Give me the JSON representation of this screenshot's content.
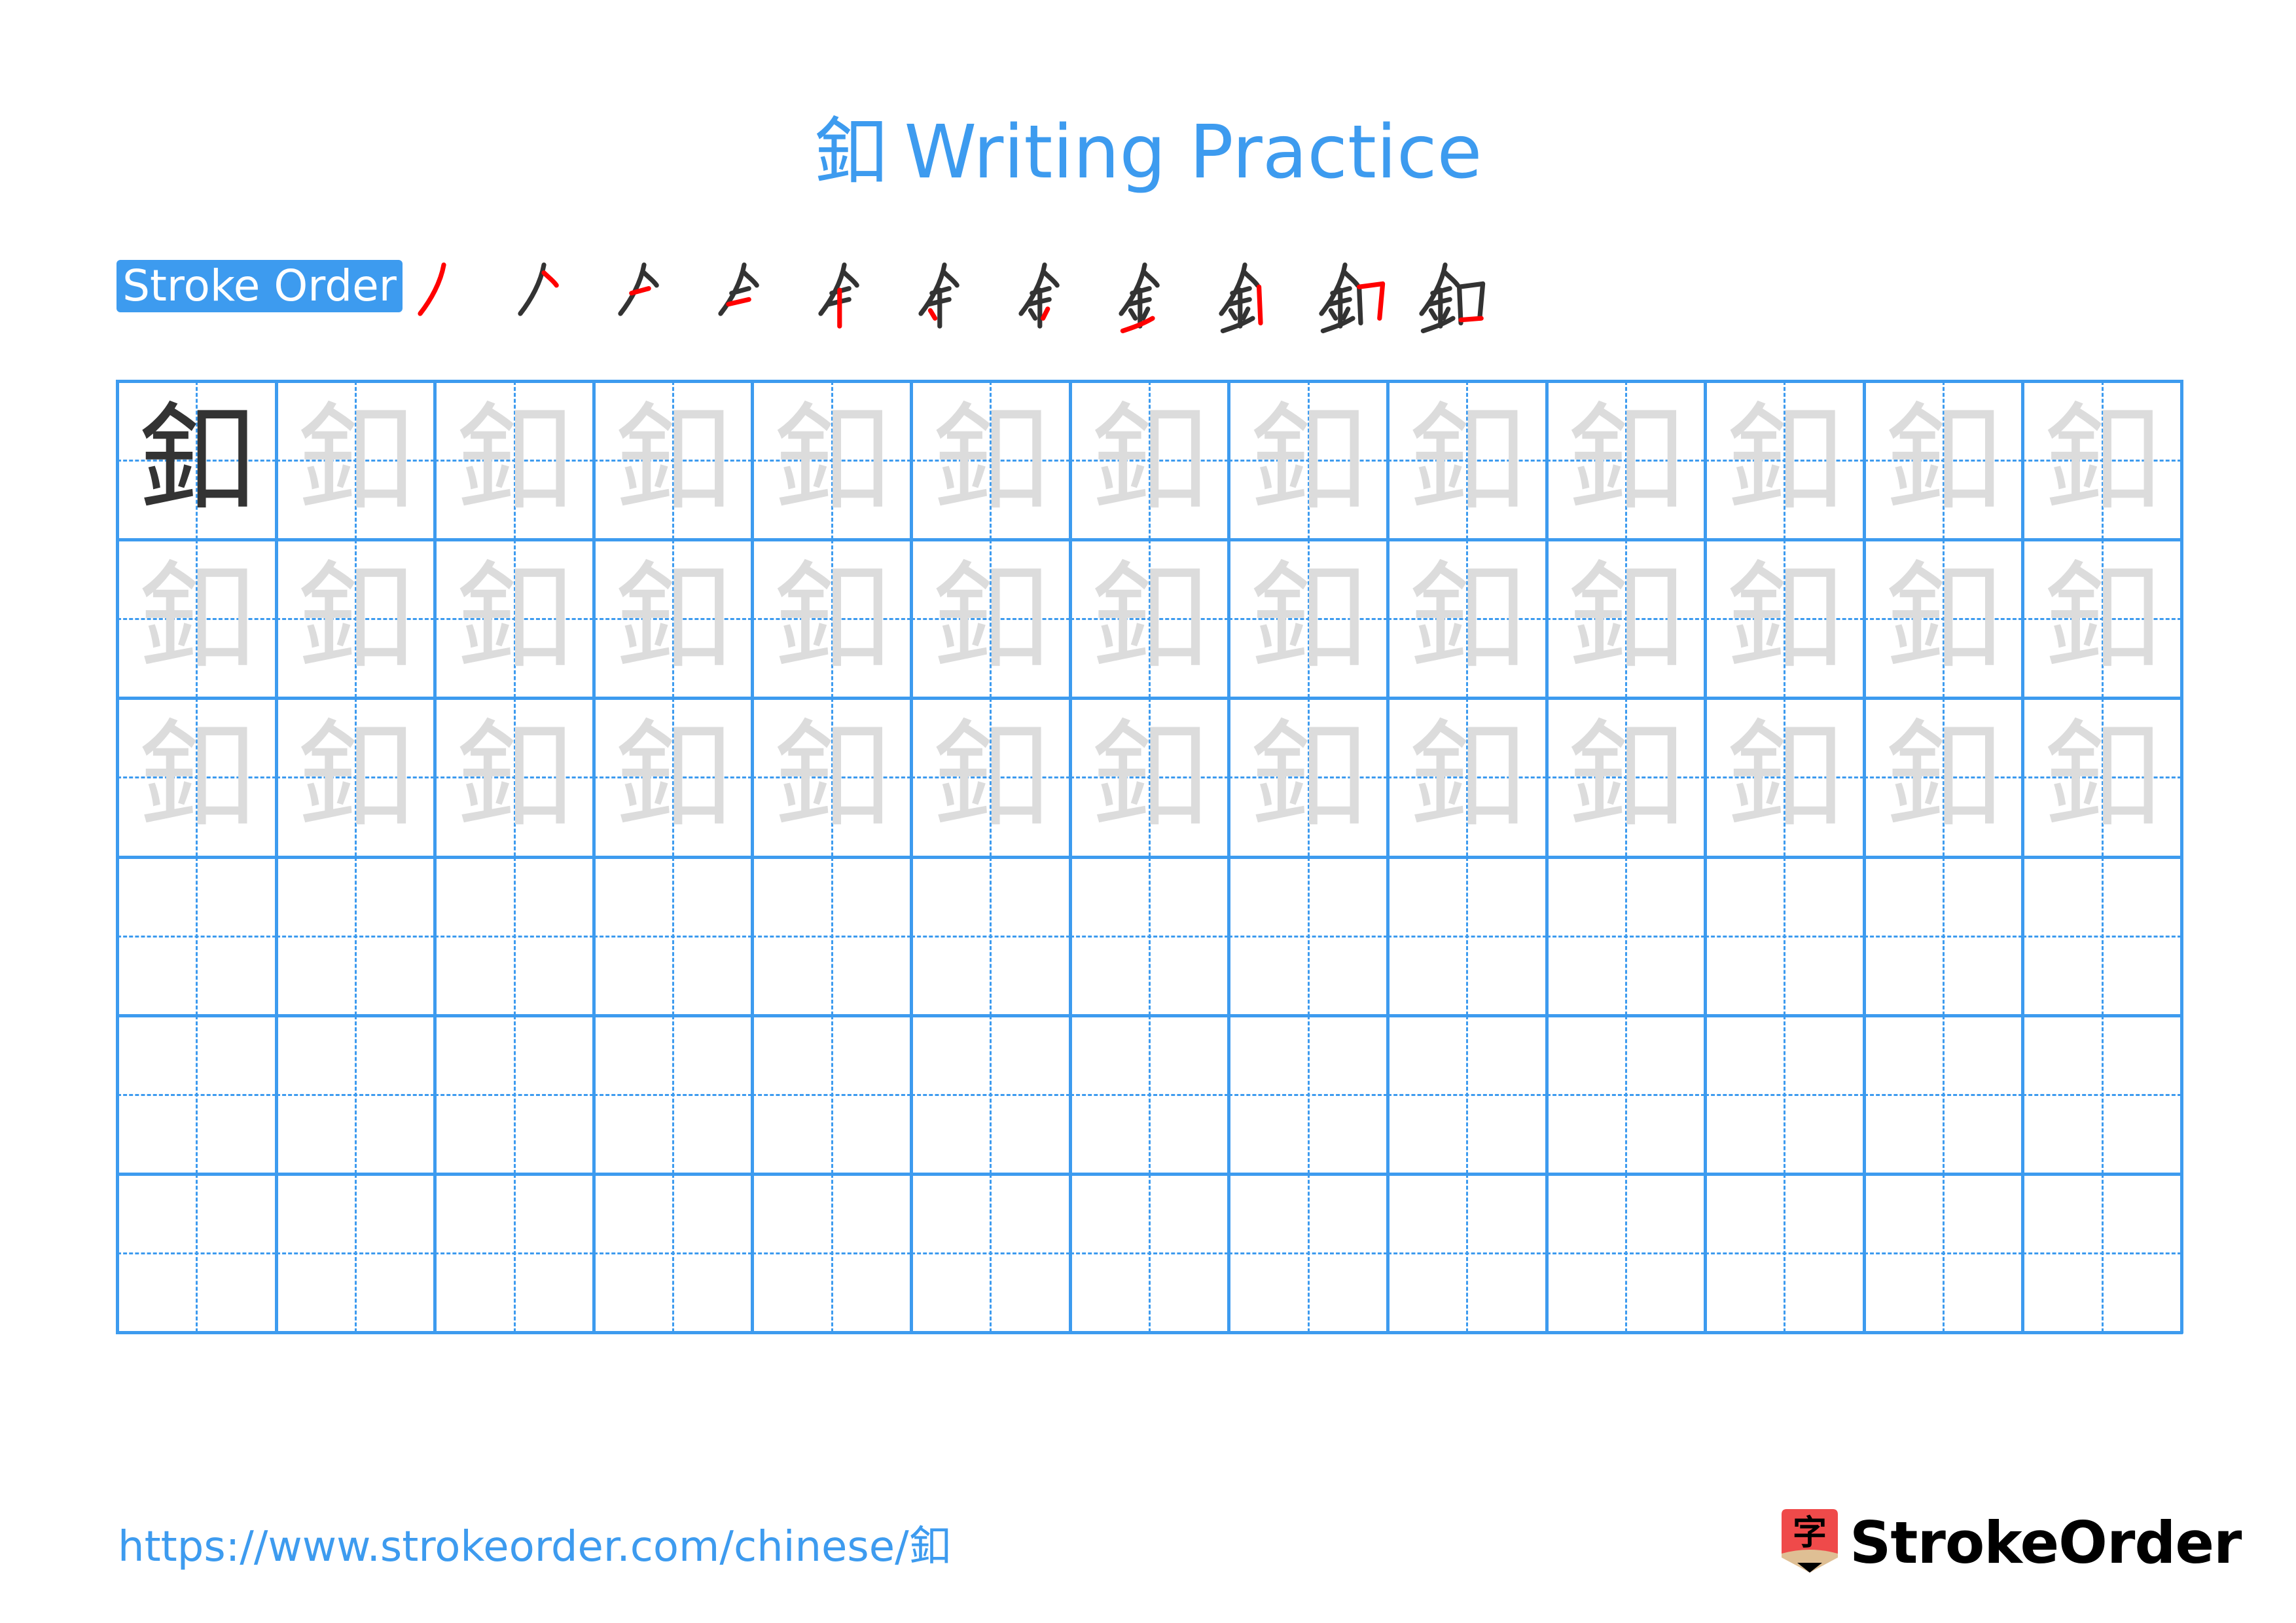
{
  "title": {
    "character": "釦",
    "text": "Writing Practice"
  },
  "stroke_order": {
    "label": "Stroke Order",
    "step_count": 11,
    "step_glyph": "釦",
    "stroke_color_current": "#ff0000",
    "stroke_color_done": "#333333"
  },
  "grid": {
    "rows": 6,
    "columns": 13,
    "character": "釦",
    "model_cells": 1,
    "trace_rows": 3,
    "empty_rows": 3,
    "line_color": "#3d9bef",
    "model_color": "#333333",
    "trace_color": "#dcdcdc"
  },
  "footer": {
    "url": "https://www.strokeorder.com/chinese/釦",
    "brand": "StrokeOrder",
    "logo_glyph": "字",
    "logo_color": "#ef4a4a",
    "logo_tip_color": "#dfbf94"
  }
}
